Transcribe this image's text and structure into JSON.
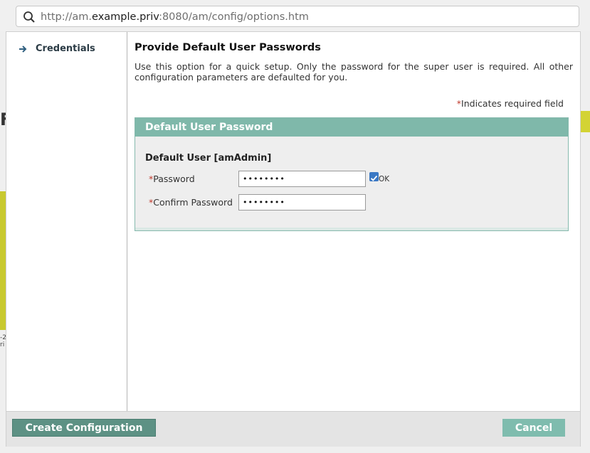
{
  "browser": {
    "url_prefix": "http://am.",
    "url_host": "example.priv",
    "url_suffix": ":8080/am/config/options.htm"
  },
  "background": {
    "glyph": "F",
    "text_line1": "-2",
    "text_line2": "ri"
  },
  "sidebar": {
    "items": [
      {
        "label": "Credentials",
        "icon": "arrow-right-icon"
      }
    ]
  },
  "main": {
    "title": "Provide Default User Passwords",
    "description": "Use this option for a quick setup. Only the password for the super user is required. All other configuration parameters are defaulted for you.",
    "required_star": "*",
    "required_note": "Indicates required field"
  },
  "panel": {
    "header": "Default User Password",
    "section_label": "Default User [amAdmin]",
    "fields": [
      {
        "star": "*",
        "label": "Password",
        "value": "••••••••",
        "status": "OK"
      },
      {
        "star": "*",
        "label": "Confirm Password",
        "value": "••••••••"
      }
    ]
  },
  "footer": {
    "create_label": "Create Configuration",
    "cancel_label": "Cancel"
  },
  "colors": {
    "accent": "#7fb8aa",
    "primary_button": "#5d9184",
    "required": "#c0392b"
  }
}
